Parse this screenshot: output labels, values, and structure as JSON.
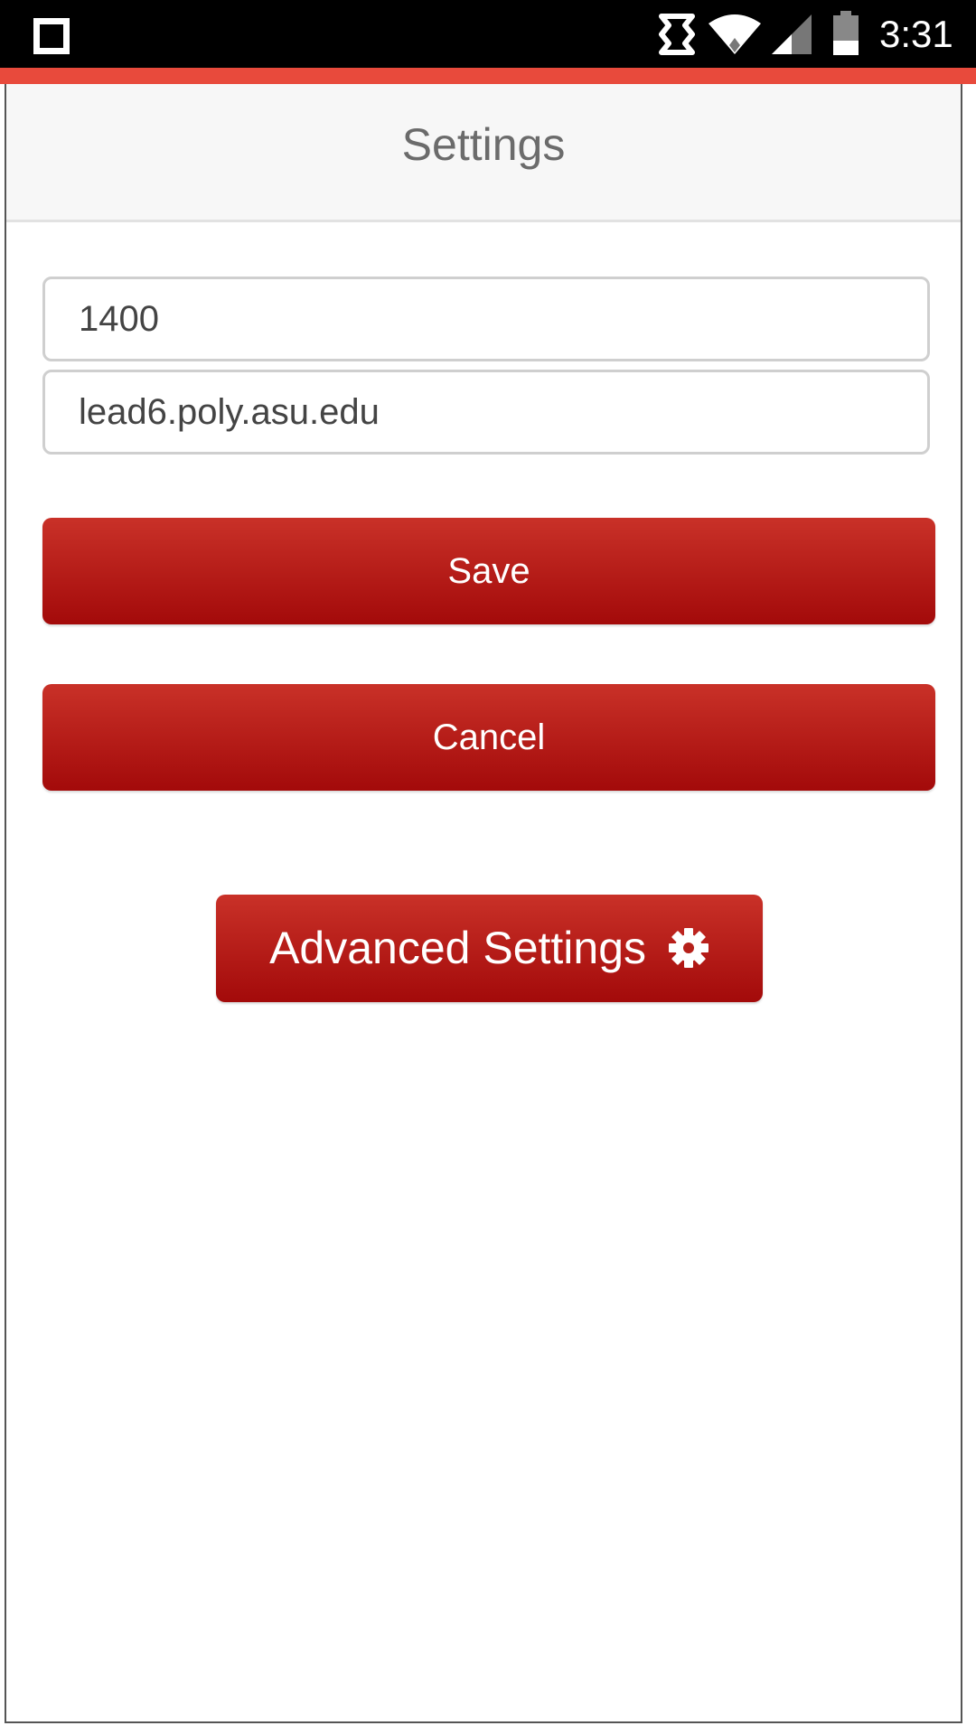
{
  "status_bar": {
    "time": "3:31",
    "icons": [
      "square-icon",
      "sync-icon",
      "wifi-icon",
      "signal-icon",
      "battery-icon"
    ]
  },
  "header": {
    "title": "Settings"
  },
  "form": {
    "port_value": "1400",
    "host_value": "lead6.poly.asu.edu"
  },
  "buttons": {
    "save_label": "Save",
    "cancel_label": "Cancel",
    "advanced_label": "Advanced Settings",
    "advanced_icon": "gear-icon"
  },
  "colors": {
    "accent_bar": "#e84a3c",
    "button_top": "#c93128",
    "button_bottom": "#a30a0a",
    "header_bg": "#f7f7f7"
  }
}
